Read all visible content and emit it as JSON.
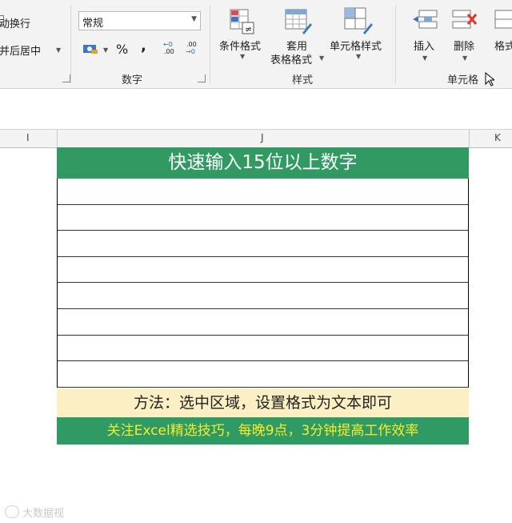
{
  "ribbon": {
    "alignment": {
      "wrap_text": "自动换行",
      "merge_center": "合并后居中"
    },
    "number": {
      "format_value": "常规",
      "group_label": "数字",
      "percent": "%",
      "comma": ",",
      "inc_decimal_top": "←0",
      "inc_decimal_bottom": ".00",
      "dec_decimal_top": ".00",
      "dec_decimal_bottom": "→0"
    },
    "styles": {
      "conditional_format": "条件格式",
      "format_table_line1": "套用",
      "format_table_line2": "表格格式",
      "cell_styles": "单元格样式",
      "group_label": "样式"
    },
    "cells": {
      "insert": "插入",
      "delete": "删除",
      "format": "格式",
      "group_label": "单元格"
    }
  },
  "sheet": {
    "columns": [
      "I",
      "J",
      "K"
    ],
    "title": "快速输入15位以上数字",
    "method": "方法：选中区域，设置格式为文本即可",
    "promo": "关注Excel精选技巧，每晚9点，3分钟提高工作效率",
    "empty_row_count": 8
  },
  "watermark": "大数据视",
  "colors": {
    "header_green": "#319962",
    "method_bg": "#fdefc4",
    "promo_text": "#f7ec2a"
  }
}
